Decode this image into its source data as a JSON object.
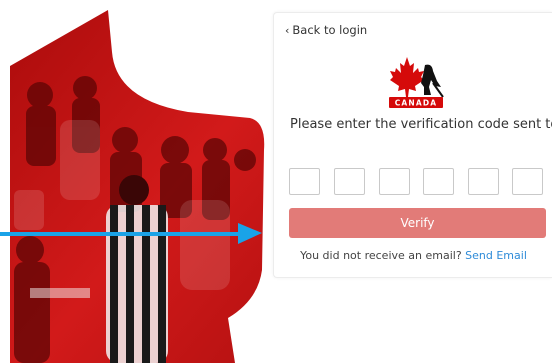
{
  "card": {
    "back_link": "Back to login",
    "back_icon": "chevron-left-icon",
    "logo_text": "CANADA",
    "prompt": "Please enter the verification code sent to",
    "code_boxes": [
      "",
      "",
      "",
      "",
      "",
      ""
    ],
    "verify_label": "Verify",
    "resend_text": "You did not receive an email?",
    "resend_link": "Send Email"
  },
  "colors": {
    "accent_red": "#d50a0a",
    "button_red": "#e27b78",
    "link_blue": "#2e8bd8",
    "arrow_blue": "#1aa3e8"
  }
}
